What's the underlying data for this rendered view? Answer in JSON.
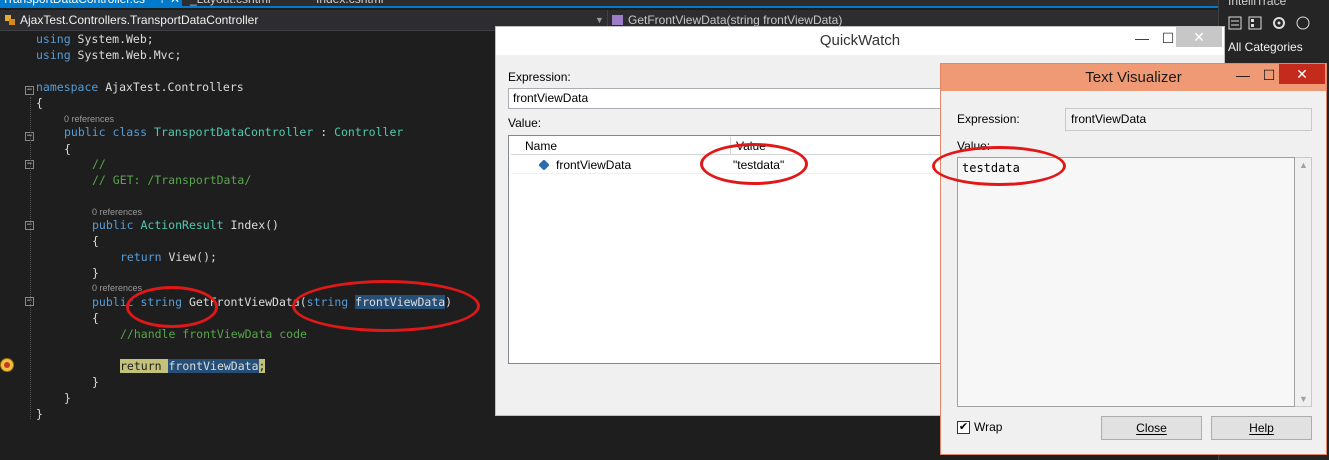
{
  "doc_tabs": [
    {
      "label": "TransportDataController.cs",
      "active": true
    },
    {
      "label": "_Layout.cshtml",
      "active": false
    },
    {
      "label": "Index.cshtml",
      "active": false
    }
  ],
  "tab_pin_glyph": "⊣",
  "tab_close_glyph": "✕",
  "navbar": {
    "left": "AjaxTest.Controllers.TransportDataController",
    "right": "GetFrontViewData(string frontViewData)"
  },
  "code": {
    "l1": {
      "kw": "using",
      "rest": " System.Web;"
    },
    "l2": {
      "kw": "using",
      "rest": " System.Web.Mvc;"
    },
    "l3": {
      "kw": "namespace",
      "rest": " AjaxTest.Controllers"
    },
    "l4": "{",
    "refs": "0 references",
    "l5": {
      "kw": "public class",
      "type": "TransportDataController",
      "sep": " : ",
      "base": "Controller"
    },
    "l6": "{",
    "l7": "//",
    "l8": "// GET: /TransportData/",
    "l9": {
      "kw1": "public",
      "type": "ActionResult",
      "rest": " Index()"
    },
    "l10": "{",
    "l11": {
      "kw": "return",
      "rest": " View();"
    },
    "l12": "}",
    "l13": {
      "kw1": "public",
      "kw2": "string",
      "name": " GetFrontViewData(",
      "kw3": "string",
      "param": "frontViewData",
      "close": ")"
    },
    "l14": "{",
    "l15": "//handle frontViewData code",
    "l16": {
      "kw": "return",
      "var": "frontViewData",
      "semi": ";"
    },
    "l17": "}",
    "l18": "}",
    "l19": "}"
  },
  "side_panel": {
    "title": "IntelliTrace",
    "category": "All Categories"
  },
  "quickwatch": {
    "title": "QuickWatch",
    "expression_label": "Expression:",
    "expression_value": "frontViewData",
    "value_label": "Value:",
    "columns": {
      "name": "Name",
      "value": "Value"
    },
    "rows": [
      {
        "name": "frontViewData",
        "value": "\"testdata\""
      }
    ]
  },
  "text_visualizer": {
    "title": "Text Visualizer",
    "expression_label": "Expression:",
    "expression_value": "frontViewData",
    "value_label": "Value:",
    "value_text": "testdata",
    "wrap_label": "Wrap",
    "wrap_checked": "✔",
    "close_label": "Close",
    "help_label": "Help"
  },
  "window_glyphs": {
    "minimize": "—",
    "maximize": "☐",
    "close": "✕"
  },
  "colors": {
    "accent": "#007acc",
    "annotation": "#e01818",
    "visualizer_title": "#ef9a74"
  }
}
